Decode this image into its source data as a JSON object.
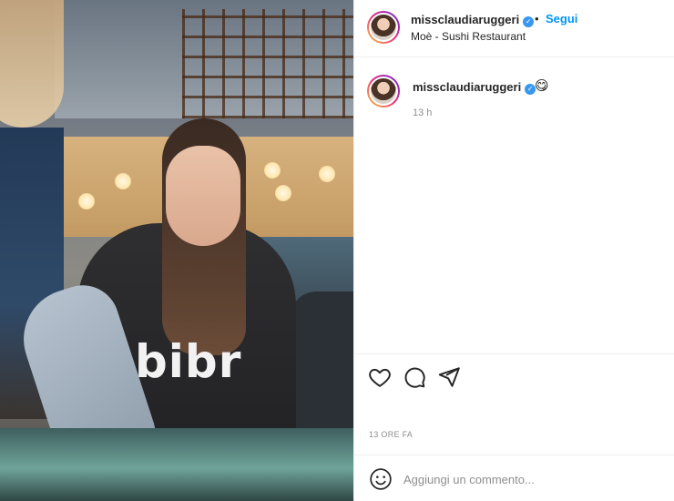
{
  "photo": {
    "logo_text": "bibr"
  },
  "post": {
    "username": "missclaudiaruggeri",
    "verified": true,
    "dot": "•",
    "follow_label": "Segui",
    "location": "Moè - Sushi Restaurant"
  },
  "caption": {
    "username": "missclaudiaruggeri",
    "text": "😋",
    "time": "13 h"
  },
  "actions": {
    "icons": [
      "heart-icon",
      "comment-icon",
      "share-icon"
    ]
  },
  "date_label": "13 ORE FA",
  "comment_box": {
    "placeholder": "Aggiungi un commento..."
  },
  "colors": {
    "link": "#0095f6",
    "verified": "#3897f0",
    "muted": "#8e8e8e",
    "text": "#262626"
  }
}
